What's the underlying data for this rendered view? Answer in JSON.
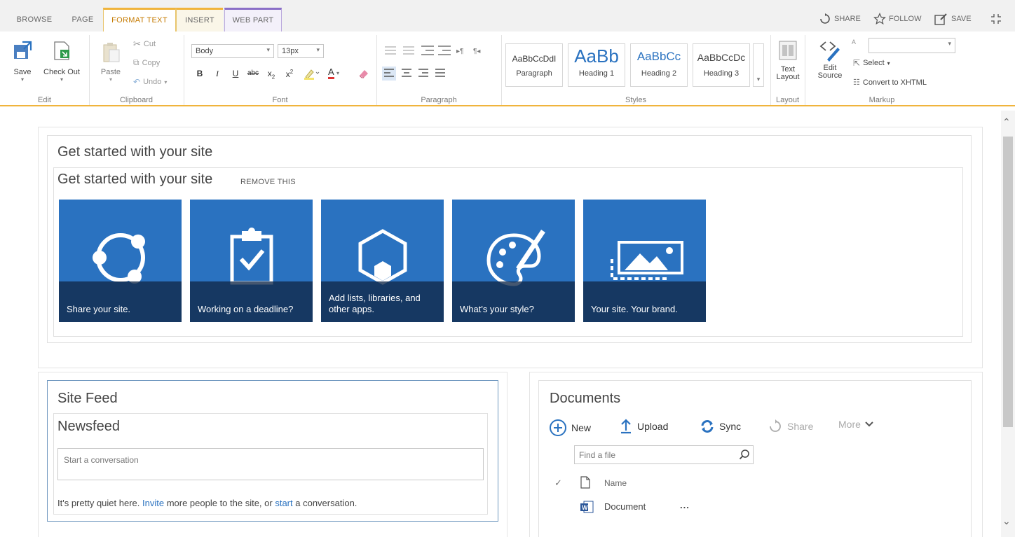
{
  "tabs": {
    "browse": "BROWSE",
    "page": "PAGE",
    "format_text": "FORMAT TEXT",
    "insert": "INSERT",
    "web_part": "WEB PART"
  },
  "top_actions": {
    "share": "SHARE",
    "follow": "FOLLOW",
    "save": "SAVE"
  },
  "ribbon": {
    "edit": {
      "save": "Save",
      "check_out": "Check Out",
      "group": "Edit"
    },
    "clipboard": {
      "paste": "Paste",
      "cut": "Cut",
      "copy": "Copy",
      "undo": "Undo",
      "group": "Clipboard"
    },
    "font": {
      "family": "Body",
      "size": "13px",
      "bold": "B",
      "italic": "I",
      "underline": "U",
      "strike": "abc",
      "subscript": "x",
      "superscript": "x",
      "font_color": "A",
      "group": "Font"
    },
    "paragraph": {
      "group": "Paragraph"
    },
    "styles": {
      "tiles": [
        {
          "sample": "AaBbCcDdI",
          "name": "Paragraph"
        },
        {
          "sample": "AaBb",
          "name": "Heading 1"
        },
        {
          "sample": "AaBbCc",
          "name": "Heading 2"
        },
        {
          "sample": "AaBbCcDc",
          "name": "Heading 3"
        }
      ],
      "group": "Styles"
    },
    "layout": {
      "text_layout_1": "Text",
      "text_layout_2": "Layout",
      "group": "Layout"
    },
    "markup": {
      "edit_source_1": "Edit",
      "edit_source_2": "Source",
      "select": "Select",
      "convert": "Convert to XHTML",
      "group": "Markup"
    }
  },
  "get_started": {
    "title": "Get started with your site",
    "inner_title": "Get started with your site",
    "remove": "REMOVE THIS",
    "tiles": [
      {
        "caption": "Share your site."
      },
      {
        "caption": "Working on a deadline?"
      },
      {
        "caption": "Add lists, libraries, and other apps."
      },
      {
        "caption": "What's your style?"
      },
      {
        "caption": "Your site. Your brand."
      }
    ]
  },
  "site_feed": {
    "title": "Site Feed",
    "newsfeed": "Newsfeed",
    "placeholder": "Start a conversation",
    "quiet_1": "It's pretty quiet here. ",
    "invite": "Invite",
    "quiet_2": " more people to the site, or ",
    "start": "start",
    "quiet_3": " a conversation."
  },
  "documents": {
    "title": "Documents",
    "commands": {
      "new": "New",
      "upload": "Upload",
      "sync": "Sync",
      "share": "Share",
      "more": "More"
    },
    "find_placeholder": "Find a file",
    "column_name": "Name",
    "rows": [
      {
        "name": "Document",
        "menu": "..."
      }
    ]
  },
  "colors": {
    "tile_blue": "#2a72c0",
    "accent_orange": "#f0b43c",
    "link_blue": "#2a72c0"
  }
}
